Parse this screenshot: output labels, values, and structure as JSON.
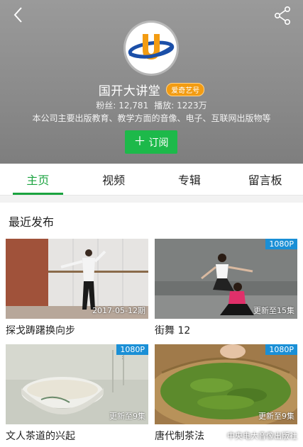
{
  "header": {
    "channel_name": "国开大讲堂",
    "badge": "爱奇艺号",
    "fans": "粉丝: 12,781",
    "plays": "播放: 1223万",
    "description": "本公司主要出版教育、教学方面的音像、电子、互联网出版物等",
    "subscribe_label": "订阅",
    "avatar_letter": "U"
  },
  "tabs": [
    {
      "label": "主页",
      "active": true
    },
    {
      "label": "视频",
      "active": false
    },
    {
      "label": "专辑",
      "active": false
    },
    {
      "label": "留言板",
      "active": false
    }
  ],
  "section": {
    "title": "最近发布"
  },
  "videos": [
    {
      "title": "探戈踌躇换向步",
      "overlay": "2017-05-12期",
      "badge": ""
    },
    {
      "title": "街舞 12",
      "overlay": "更新至15集",
      "badge": "1080P"
    },
    {
      "title": "文人茶道的兴起",
      "overlay": "更新至9集",
      "badge": "1080P"
    },
    {
      "title": "唐代制茶法",
      "overlay": "更新至9集",
      "badge": "1080P"
    }
  ],
  "watermark": {
    "text": "中央电大音像出版社"
  },
  "colors": {
    "accent": "#1aa33f",
    "subscribe": "#1db94a",
    "badge_blue": "#1a8fd6",
    "badge_orange": "#f39c12"
  }
}
